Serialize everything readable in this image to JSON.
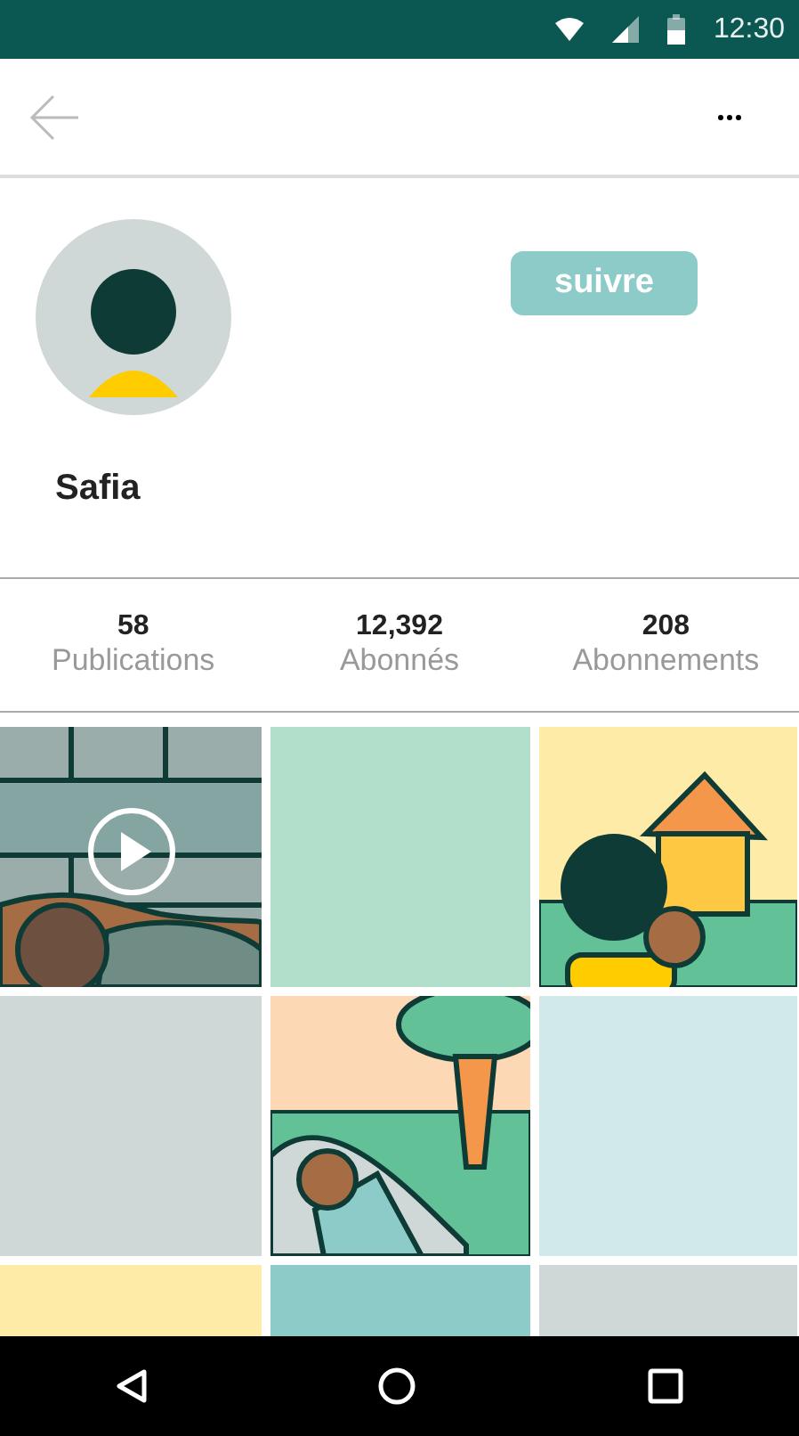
{
  "status_bar": {
    "time": "12:30"
  },
  "profile": {
    "name": "Safia",
    "follow_button": "suivre"
  },
  "stats": [
    {
      "value": "58",
      "label": "Publications"
    },
    {
      "value": "12,392",
      "label": "Abonnés"
    },
    {
      "value": "208",
      "label": "Abonnements"
    }
  ],
  "posts": [
    {
      "kind": "video"
    },
    {
      "kind": "placeholder",
      "color": "#b2dfcc"
    },
    {
      "kind": "picture"
    },
    {
      "kind": "placeholder",
      "color": "#cfd8d7"
    },
    {
      "kind": "picture"
    },
    {
      "kind": "placeholder",
      "color": "#d2e9ea"
    },
    {
      "kind": "placeholder",
      "color": "#fdeba7"
    },
    {
      "kind": "placeholder",
      "color": "#8ccbc8"
    },
    {
      "kind": "placeholder",
      "color": "#cfd8d7"
    }
  ]
}
